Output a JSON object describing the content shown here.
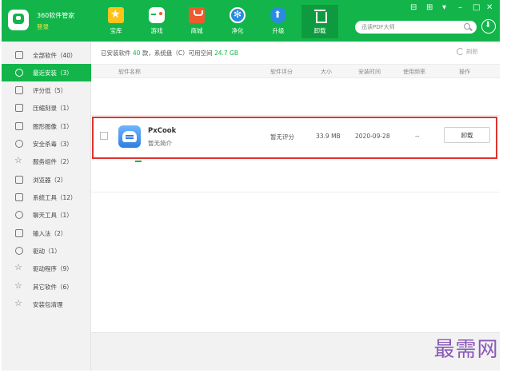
{
  "header": {
    "app_title": "360软件管家",
    "login": "登录",
    "nav": [
      {
        "label": "宝库",
        "icon": "star-icon"
      },
      {
        "label": "游戏",
        "icon": "gamepad-icon"
      },
      {
        "label": "商城",
        "icon": "shopping-bag-icon"
      },
      {
        "label": "净化",
        "icon": "clean-icon"
      },
      {
        "label": "升级",
        "icon": "upgrade-icon"
      },
      {
        "label": "卸载",
        "icon": "trash-icon"
      }
    ],
    "active_nav": "卸载",
    "search_placeholder": "迅读PDF大师",
    "window_controls": {
      "skin": "⊟",
      "grid": "⊞",
      "menu": "▾",
      "minimize": "–",
      "maximize": "□",
      "close": "✕"
    }
  },
  "sidebar": {
    "items": [
      {
        "label": "全部软件（40）",
        "icon": "grid-icon"
      },
      {
        "label": "最近安装（3）",
        "icon": "clock-icon",
        "active": true
      },
      {
        "label": "评分低（5）",
        "icon": "rating-icon"
      },
      {
        "label": "压缩刻录（1）",
        "icon": "archive-icon"
      },
      {
        "label": "图形图像（1）",
        "icon": "image-icon"
      },
      {
        "label": "安全杀毒（3）",
        "icon": "shield-icon"
      },
      {
        "label": "服务组件（2）",
        "icon": "star-outline-icon"
      },
      {
        "label": "浏览器（2）",
        "icon": "browser-icon"
      },
      {
        "label": "系统工具（12）",
        "icon": "tools-icon"
      },
      {
        "label": "聊天工具（1）",
        "icon": "chat-icon"
      },
      {
        "label": "输入法（2）",
        "icon": "keyboard-icon"
      },
      {
        "label": "驱动（1）",
        "icon": "driver-icon"
      },
      {
        "label": "驱动程序（9）",
        "icon": "star-outline-icon"
      },
      {
        "label": "其它软件（6）",
        "icon": "star-outline-icon"
      },
      {
        "label": "安装包清理",
        "icon": "star-outline-icon"
      }
    ]
  },
  "content": {
    "summary": {
      "prefix": "已安装软件",
      "count": "40",
      "mid": "款，系统盘（C）可用空间",
      "space": "24.7 GB"
    },
    "refresh": "刷新",
    "columns": [
      "软件名称",
      "软件评分",
      "大小",
      "安装时间",
      "使用频率",
      "操作"
    ],
    "rows": [
      {
        "name": "PxCook",
        "desc": "暂无简介",
        "rating": "暂无评分",
        "size": "33.9 MB",
        "installed": "2020-09-28",
        "frequency": "--",
        "action": "卸载"
      }
    ]
  },
  "watermark": "最需网",
  "colors": {
    "brand": "#13b54b",
    "highlight": "#e0332f",
    "watermark": "#8a58b8"
  }
}
